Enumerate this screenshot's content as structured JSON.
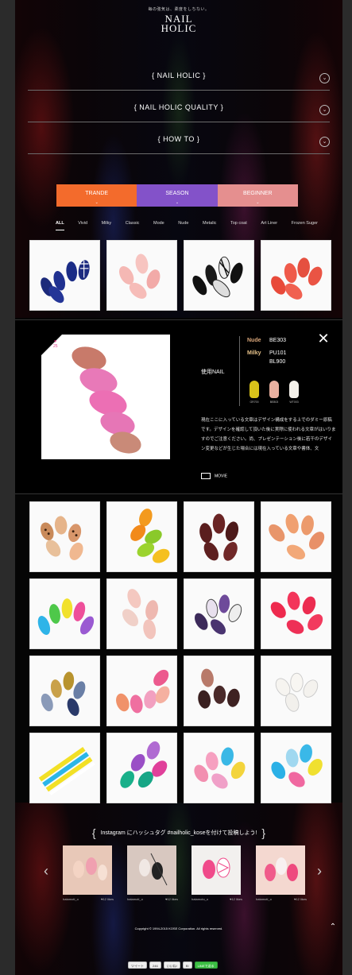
{
  "header": {
    "tagline": "毎の強気は、柔度をしちない。",
    "logo_line1": "NAIL",
    "logo_line2": "HOLIC"
  },
  "nav": [
    {
      "label": "{ NAIL HOLIC }"
    },
    {
      "label": "{ NAIL HOLIC QUALITY }"
    },
    {
      "label": "{ HOW TO }"
    }
  ],
  "tabs": [
    {
      "label": "TRANDE",
      "color": "#f36b2c"
    },
    {
      "label": "SEASON",
      "color": "#8352c9"
    },
    {
      "label": "BEGINNER",
      "color": "#e58f8f"
    }
  ],
  "categories": [
    "ALL",
    "Vivid",
    "Milky",
    "Classic",
    "Mode",
    "Nude",
    "Metalic",
    "Top coat",
    "Art Liner",
    "Frozen Suger"
  ],
  "active_category": "ALL",
  "detail": {
    "likes_icon": "heart-icon",
    "likes_count": "25",
    "used_label": "使用NAIL",
    "codes": [
      {
        "key": "Nude",
        "values": [
          "BE303"
        ]
      },
      {
        "key": "Milky",
        "values": [
          "PU101",
          "BL900"
        ]
      }
    ],
    "swatches": [
      {
        "label": "GR700",
        "color": "#d8c21a"
      },
      {
        "label": "BE803",
        "color": "#e9b0a0"
      },
      {
        "label": "WT003",
        "color": "#f4f1ea"
      }
    ],
    "description": "現在ここに入っている文章はデザイン構成をする上でのダミー原稿です。デザインを確認して頂いた後に実際に使われる文章がはいりますのでご注意ください。尚、プレゼンテーション後に若干のデザイン変更などが生じた場合には現在入っている文章や書体、文",
    "movie_label": "MOVIE"
  },
  "instagram": {
    "title": "Instagram にハッシュタグ #nailholic_koseを付けて投稿しよう!",
    "posts": [
      {
        "user": "hatamoti_o",
        "likes": "♥12 likes"
      },
      {
        "user": "hatamoti_o",
        "likes": "♥12 likes"
      },
      {
        "user": "hatamoto_o",
        "likes": "♥12 likes"
      },
      {
        "user": "hatamoti_o",
        "likes": "♥12 likes"
      }
    ]
  },
  "footer": {
    "copyright": "Copyright © 1994-2015 KOSE Corporation. All rights reserved.",
    "share": [
      "ツイート",
      "246",
      "いいね!",
      "B!",
      "LINEで送る"
    ]
  }
}
